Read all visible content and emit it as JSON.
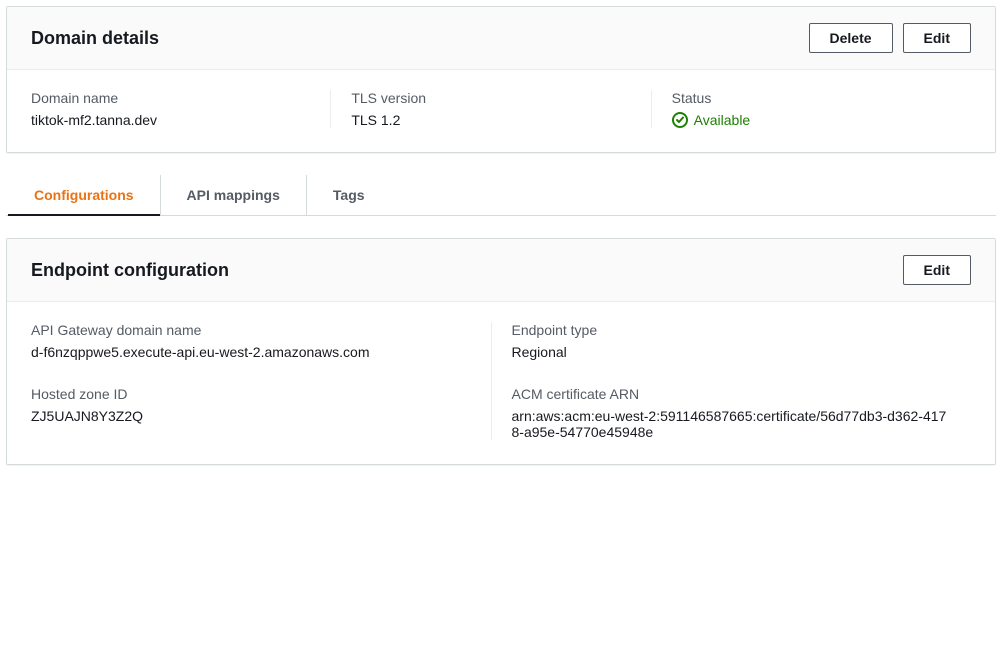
{
  "domain_details": {
    "title": "Domain details",
    "delete_label": "Delete",
    "edit_label": "Edit",
    "fields": {
      "domain_name": {
        "label": "Domain name",
        "value": "tiktok-mf2.tanna.dev"
      },
      "tls_version": {
        "label": "TLS version",
        "value": "TLS 1.2"
      },
      "status": {
        "label": "Status",
        "value": "Available"
      }
    }
  },
  "tabs": {
    "configurations": "Configurations",
    "api_mappings": "API mappings",
    "tags": "Tags"
  },
  "endpoint_config": {
    "title": "Endpoint configuration",
    "edit_label": "Edit",
    "fields": {
      "api_gateway_domain": {
        "label": "API Gateway domain name",
        "value": "d-f6nzqppwe5.execute-api.eu-west-2.amazonaws.com"
      },
      "hosted_zone_id": {
        "label": "Hosted zone ID",
        "value": "ZJ5UAJN8Y3Z2Q"
      },
      "endpoint_type": {
        "label": "Endpoint type",
        "value": "Regional"
      },
      "acm_arn": {
        "label": "ACM certificate ARN",
        "value": "arn:aws:acm:eu-west-2:591146587665:certificate/56d77db3-d362-4178-a95e-54770e45948e"
      }
    }
  },
  "colors": {
    "accent": "#ec7211",
    "success": "#1d8102"
  }
}
